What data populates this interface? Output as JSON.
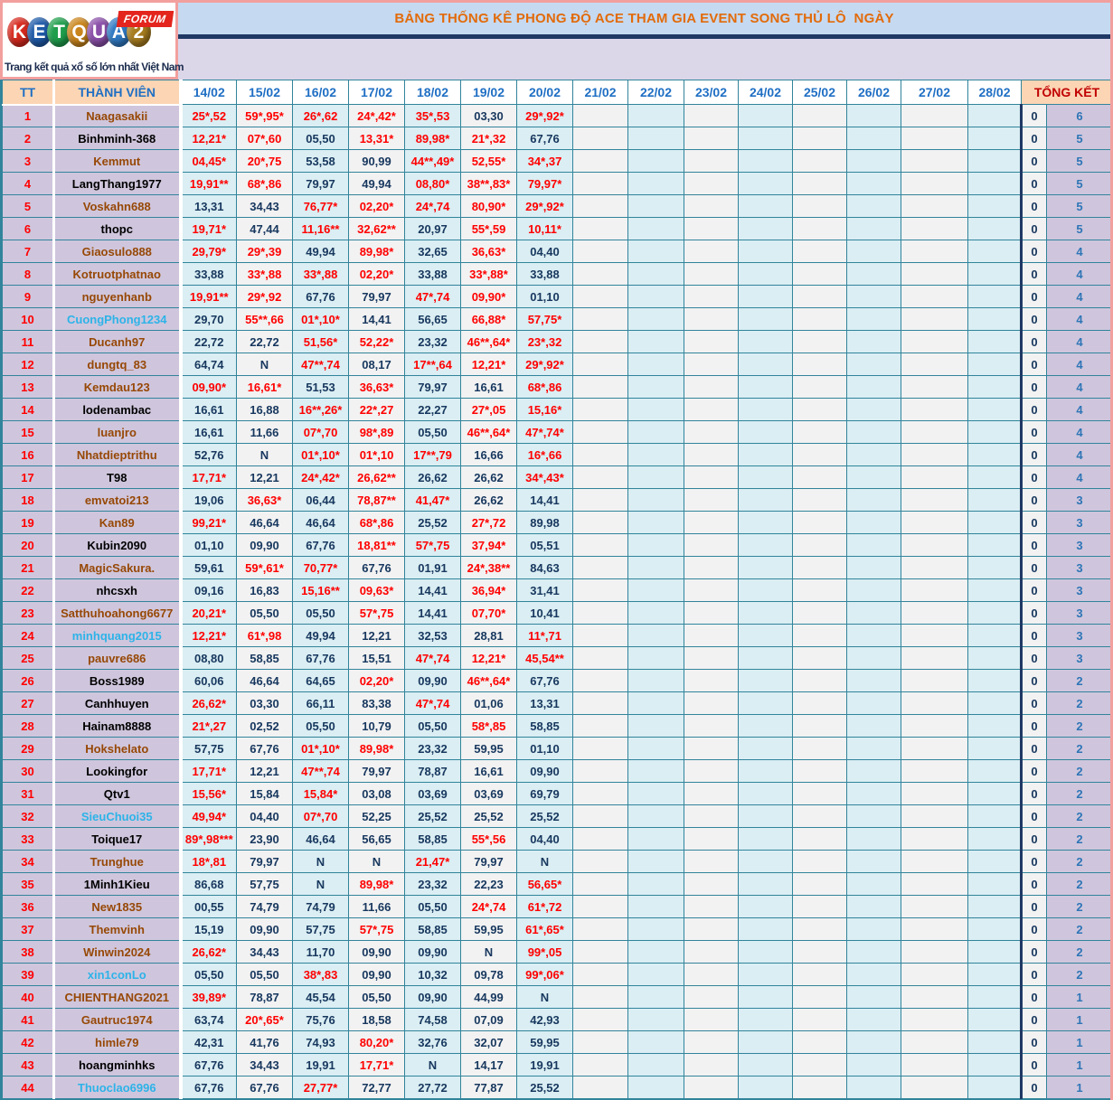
{
  "logo": {
    "letters": [
      {
        "ch": "K",
        "color": "#d6291e"
      },
      {
        "ch": "E",
        "color": "#1e5aa8"
      },
      {
        "ch": "T",
        "color": "#1f9e4c"
      },
      {
        "ch": "Q",
        "color": "#c9851c"
      },
      {
        "ch": "U",
        "color": "#8a4fa8"
      },
      {
        "ch": "A",
        "color": "#2f79c2"
      },
      {
        "ch": "2",
        "color": "#a67c1f"
      }
    ],
    "forum_label": "FORUM",
    "tagline": "Trang kết quả xổ số lớn nhất Việt Nam"
  },
  "title": "BẢNG THỐNG KÊ PHONG ĐỘ ACE THAM GIA EVENT SONG THỦ LÔ  NGÀY",
  "colors": {
    "grid": "#31849b",
    "title_text": "#e26b0a",
    "title_band": "#c5d9f1",
    "navy_line": "#1f3864",
    "lavender_band": "#dcd6e9",
    "header_peach": "#fcd5b4",
    "cell_cyan": "#daeef3",
    "cell_gray": "#f2f2f2",
    "cell_lavender": "#cfc6dd",
    "value_red": "#ff0000",
    "value_dark": "#17375e",
    "pink_frame": "#f2a09e"
  },
  "table": {
    "tt_header": "TT",
    "member_header": "THÀNH VIÊN",
    "summary_header": "TỔNG KẾT",
    "dates": [
      "14/02",
      "15/02",
      "16/02",
      "17/02",
      "18/02",
      "19/02",
      "20/02",
      "21/02",
      "22/02",
      "23/02",
      "24/02",
      "25/02",
      "26/02",
      "27/02",
      "28/02"
    ],
    "rows": [
      {
        "tt": "1",
        "name": "Naagasakii",
        "name_color": "brown",
        "values": [
          "25*,52",
          "59*,95*",
          "26*,62",
          "24*,42*",
          "35*,53",
          "03,30",
          "29*,92*"
        ],
        "zero": "0",
        "total": "6"
      },
      {
        "tt": "2",
        "name": "Binhminh-368",
        "name_color": "black",
        "values": [
          "12,21*",
          "07*,60",
          "05,50",
          "13,31*",
          "89,98*",
          "21*,32",
          "67,76"
        ],
        "zero": "0",
        "total": "5"
      },
      {
        "tt": "3",
        "name": "Kemmut",
        "name_color": "brown",
        "values": [
          "04,45*",
          "20*,75",
          "53,58",
          "90,99",
          "44**,49*",
          "52,55*",
          "34*,37"
        ],
        "zero": "0",
        "total": "5"
      },
      {
        "tt": "4",
        "name": "LangThang1977",
        "name_color": "black",
        "values": [
          "19,91**",
          "68*,86",
          "79,97",
          "49,94",
          "08,80*",
          "38**,83*",
          "79,97*"
        ],
        "zero": "0",
        "total": "5"
      },
      {
        "tt": "5",
        "name": "Voskahn688",
        "name_color": "brown",
        "values": [
          "13,31",
          "34,43",
          "76,77*",
          "02,20*",
          "24*,74",
          "80,90*",
          "29*,92*"
        ],
        "zero": "0",
        "total": "5"
      },
      {
        "tt": "6",
        "name": "thopc",
        "name_color": "black",
        "values": [
          "19,71*",
          "47,44",
          "11,16**",
          "32,62**",
          "20,97",
          "55*,59",
          "10,11*"
        ],
        "zero": "0",
        "total": "5"
      },
      {
        "tt": "7",
        "name": "Giaosulo888",
        "name_color": "brown",
        "values": [
          "29,79*",
          "29*,39",
          "49,94",
          "89,98*",
          "32,65",
          "36,63*",
          "04,40"
        ],
        "zero": "0",
        "total": "4"
      },
      {
        "tt": "8",
        "name": "Kotruotphatnao",
        "name_color": "brown",
        "values": [
          "33,88",
          "33*,88",
          "33*,88",
          "02,20*",
          "33,88",
          "33*,88*",
          "33,88"
        ],
        "zero": "0",
        "total": "4"
      },
      {
        "tt": "9",
        "name": "nguyenhanb",
        "name_color": "brown",
        "values": [
          "19,91**",
          "29*,92",
          "67,76",
          "79,97",
          "47*,74",
          "09,90*",
          "01,10"
        ],
        "zero": "0",
        "total": "4"
      },
      {
        "tt": "10",
        "name": "CuongPhong1234",
        "name_color": "cyan",
        "values": [
          "29,70",
          "55**,66",
          "01*,10*",
          "14,41",
          "56,65",
          "66,88*",
          "57,75*"
        ],
        "zero": "0",
        "total": "4"
      },
      {
        "tt": "11",
        "name": "Ducanh97",
        "name_color": "brown",
        "values": [
          "22,72",
          "22,72",
          "51,56*",
          "52,22*",
          "23,32",
          "46**,64*",
          "23*,32"
        ],
        "zero": "0",
        "total": "4"
      },
      {
        "tt": "12",
        "name": "dungtq_83",
        "name_color": "brown",
        "values": [
          "64,74",
          "N",
          "47**,74",
          "08,17",
          "17**,64",
          "12,21*",
          "29*,92*"
        ],
        "zero": "0",
        "total": "4"
      },
      {
        "tt": "13",
        "name": "Kemdau123",
        "name_color": "brown",
        "values": [
          "09,90*",
          "16,61*",
          "51,53",
          "36,63*",
          "79,97",
          "16,61",
          "68*,86"
        ],
        "zero": "0",
        "total": "4"
      },
      {
        "tt": "14",
        "name": "lodenambac",
        "name_color": "black",
        "values": [
          "16,61",
          "16,88",
          "16**,26*",
          "22*,27",
          "22,27",
          "27*,05",
          "15,16*"
        ],
        "zero": "0",
        "total": "4"
      },
      {
        "tt": "15",
        "name": "luanjro",
        "name_color": "brown",
        "values": [
          "16,61",
          "11,66",
          "07*,70",
          "98*,89",
          "05,50",
          "46**,64*",
          "47*,74*"
        ],
        "zero": "0",
        "total": "4"
      },
      {
        "tt": "16",
        "name": "Nhatdieptrithu",
        "name_color": "brown",
        "values": [
          "52,76",
          "N",
          "01*,10*",
          "01*,10",
          "17**,79",
          "16,66",
          "16*,66"
        ],
        "zero": "0",
        "total": "4"
      },
      {
        "tt": "17",
        "name": "T98",
        "name_color": "black",
        "values": [
          "17,71*",
          "12,21",
          "24*,42*",
          "26,62**",
          "26,62",
          "26,62",
          "34*,43*"
        ],
        "zero": "0",
        "total": "4"
      },
      {
        "tt": "18",
        "name": "emvatoi213",
        "name_color": "brown",
        "values": [
          "19,06",
          "36,63*",
          "06,44",
          "78,87**",
          "41,47*",
          "26,62",
          "14,41"
        ],
        "zero": "0",
        "total": "3"
      },
      {
        "tt": "19",
        "name": "Kan89",
        "name_color": "brown",
        "values": [
          "99,21*",
          "46,64",
          "46,64",
          "68*,86",
          "25,52",
          "27*,72",
          "89,98"
        ],
        "zero": "0",
        "total": "3"
      },
      {
        "tt": "20",
        "name": "Kubin2090",
        "name_color": "black",
        "values": [
          "01,10",
          "09,90",
          "67,76",
          "18,81**",
          "57*,75",
          "37,94*",
          "05,51"
        ],
        "zero": "0",
        "total": "3"
      },
      {
        "tt": "21",
        "name": "MagicSakura.",
        "name_color": "brown",
        "values": [
          "59,61",
          "59*,61*",
          "70,77*",
          "67,76",
          "01,91",
          "24*,38**",
          "84,63"
        ],
        "zero": "0",
        "total": "3"
      },
      {
        "tt": "22",
        "name": "nhcsxh",
        "name_color": "black",
        "values": [
          "09,16",
          "16,83",
          "15,16**",
          "09,63*",
          "14,41",
          "36,94*",
          "31,41"
        ],
        "zero": "0",
        "total": "3"
      },
      {
        "tt": "23",
        "name": "Satthuhoahong6677",
        "name_color": "brown",
        "values": [
          "20,21*",
          "05,50",
          "05,50",
          "57*,75",
          "14,41",
          "07,70*",
          "10,41"
        ],
        "zero": "0",
        "total": "3"
      },
      {
        "tt": "24",
        "name": "minhquang2015",
        "name_color": "cyan",
        "values": [
          "12,21*",
          "61*,98",
          "49,94",
          "12,21",
          "32,53",
          "28,81",
          "11*,71"
        ],
        "zero": "0",
        "total": "3"
      },
      {
        "tt": "25",
        "name": "pauvre686",
        "name_color": "brown",
        "values": [
          "08,80",
          "58,85",
          "67,76",
          "15,51",
          "47*,74",
          "12,21*",
          "45,54**"
        ],
        "zero": "0",
        "total": "3"
      },
      {
        "tt": "26",
        "name": "Boss1989",
        "name_color": "black",
        "values": [
          "60,06",
          "46,64",
          "64,65",
          "02,20*",
          "09,90",
          "46**,64*",
          "67,76"
        ],
        "zero": "0",
        "total": "2"
      },
      {
        "tt": "27",
        "name": "Canhhuyen",
        "name_color": "black",
        "values": [
          "26,62*",
          "03,30",
          "66,11",
          "83,38",
          "47*,74",
          "01,06",
          "13,31"
        ],
        "zero": "0",
        "total": "2"
      },
      {
        "tt": "28",
        "name": "Hainam8888",
        "name_color": "black",
        "values": [
          "21*,27",
          "02,52",
          "05,50",
          "10,79",
          "05,50",
          "58*,85",
          "58,85"
        ],
        "zero": "0",
        "total": "2"
      },
      {
        "tt": "29",
        "name": "Hokshelato",
        "name_color": "brown",
        "values": [
          "57,75",
          "67,76",
          "01*,10*",
          "89,98*",
          "23,32",
          "59,95",
          "01,10"
        ],
        "zero": "0",
        "total": "2"
      },
      {
        "tt": "30",
        "name": "Lookingfor",
        "name_color": "black",
        "values": [
          "17,71*",
          "12,21",
          "47**,74",
          "79,97",
          "78,87",
          "16,61",
          "09,90"
        ],
        "zero": "0",
        "total": "2"
      },
      {
        "tt": "31",
        "name": "Qtv1",
        "name_color": "black",
        "values": [
          "15,56*",
          "15,84",
          "15,84*",
          "03,08",
          "03,69",
          "03,69",
          "69,79"
        ],
        "zero": "0",
        "total": "2"
      },
      {
        "tt": "32",
        "name": "SieuChuoi35",
        "name_color": "cyan",
        "values": [
          "49,94*",
          "04,40",
          "07*,70",
          "52,25",
          "25,52",
          "25,52",
          "25,52"
        ],
        "zero": "0",
        "total": "2"
      },
      {
        "tt": "33",
        "name": "Toique17",
        "name_color": "black",
        "values": [
          "89*,98***",
          "23,90",
          "46,64",
          "56,65",
          "58,85",
          "55*,56",
          "04,40"
        ],
        "zero": "0",
        "total": "2"
      },
      {
        "tt": "34",
        "name": "Trunghue",
        "name_color": "brown",
        "values": [
          "18*,81",
          "79,97",
          "N",
          "N",
          "21,47*",
          "79,97",
          "N"
        ],
        "zero": "0",
        "total": "2"
      },
      {
        "tt": "35",
        "name": "1Minh1Kieu",
        "name_color": "black",
        "values": [
          "86,68",
          "57,75",
          "N",
          "89,98*",
          "23,32",
          "22,23",
          "56,65*"
        ],
        "zero": "0",
        "total": "2"
      },
      {
        "tt": "36",
        "name": "New1835",
        "name_color": "brown",
        "values": [
          "00,55",
          "74,79",
          "74,79",
          "11,66",
          "05,50",
          "24*,74",
          "61*,72"
        ],
        "zero": "0",
        "total": "2"
      },
      {
        "tt": "37",
        "name": "Themvinh",
        "name_color": "brown",
        "values": [
          "15,19",
          "09,90",
          "57,75",
          "57*,75",
          "58,85",
          "59,95",
          "61*,65*"
        ],
        "zero": "0",
        "total": "2"
      },
      {
        "tt": "38",
        "name": "Winwin2024",
        "name_color": "brown",
        "values": [
          "26,62*",
          "34,43",
          "11,70",
          "09,90",
          "09,90",
          "N",
          "99*,05"
        ],
        "zero": "0",
        "total": "2"
      },
      {
        "tt": "39",
        "name": "xin1conLo",
        "name_color": "cyan",
        "values": [
          "05,50",
          "05,50",
          "38*,83",
          "09,90",
          "10,32",
          "09,78",
          "99*,06*"
        ],
        "zero": "0",
        "total": "2"
      },
      {
        "tt": "40",
        "name": "CHIENTHANG2021",
        "name_color": "brown",
        "values": [
          "39,89*",
          "78,87",
          "45,54",
          "05,50",
          "09,90",
          "44,99",
          "N"
        ],
        "zero": "0",
        "total": "1"
      },
      {
        "tt": "41",
        "name": "Gautruc1974",
        "name_color": "brown",
        "values": [
          "63,74",
          "20*,65*",
          "75,76",
          "18,58",
          "74,58",
          "07,09",
          "42,93"
        ],
        "zero": "0",
        "total": "1"
      },
      {
        "tt": "42",
        "name": "himle79",
        "name_color": "brown",
        "values": [
          "42,31",
          "41,76",
          "74,93",
          "80,20*",
          "32,76",
          "32,07",
          "59,95"
        ],
        "zero": "0",
        "total": "1"
      },
      {
        "tt": "43",
        "name": "hoangminhks",
        "name_color": "black",
        "values": [
          "67,76",
          "34,43",
          "19,91",
          "17,71*",
          "N",
          "14,17",
          "19,91"
        ],
        "zero": "0",
        "total": "1"
      },
      {
        "tt": "44",
        "name": "Thuoclao6996",
        "name_color": "cyan",
        "values": [
          "67,76",
          "67,76",
          "27,77*",
          "72,77",
          "27,72",
          "77,87",
          "25,52"
        ],
        "zero": "0",
        "total": "1"
      }
    ]
  }
}
